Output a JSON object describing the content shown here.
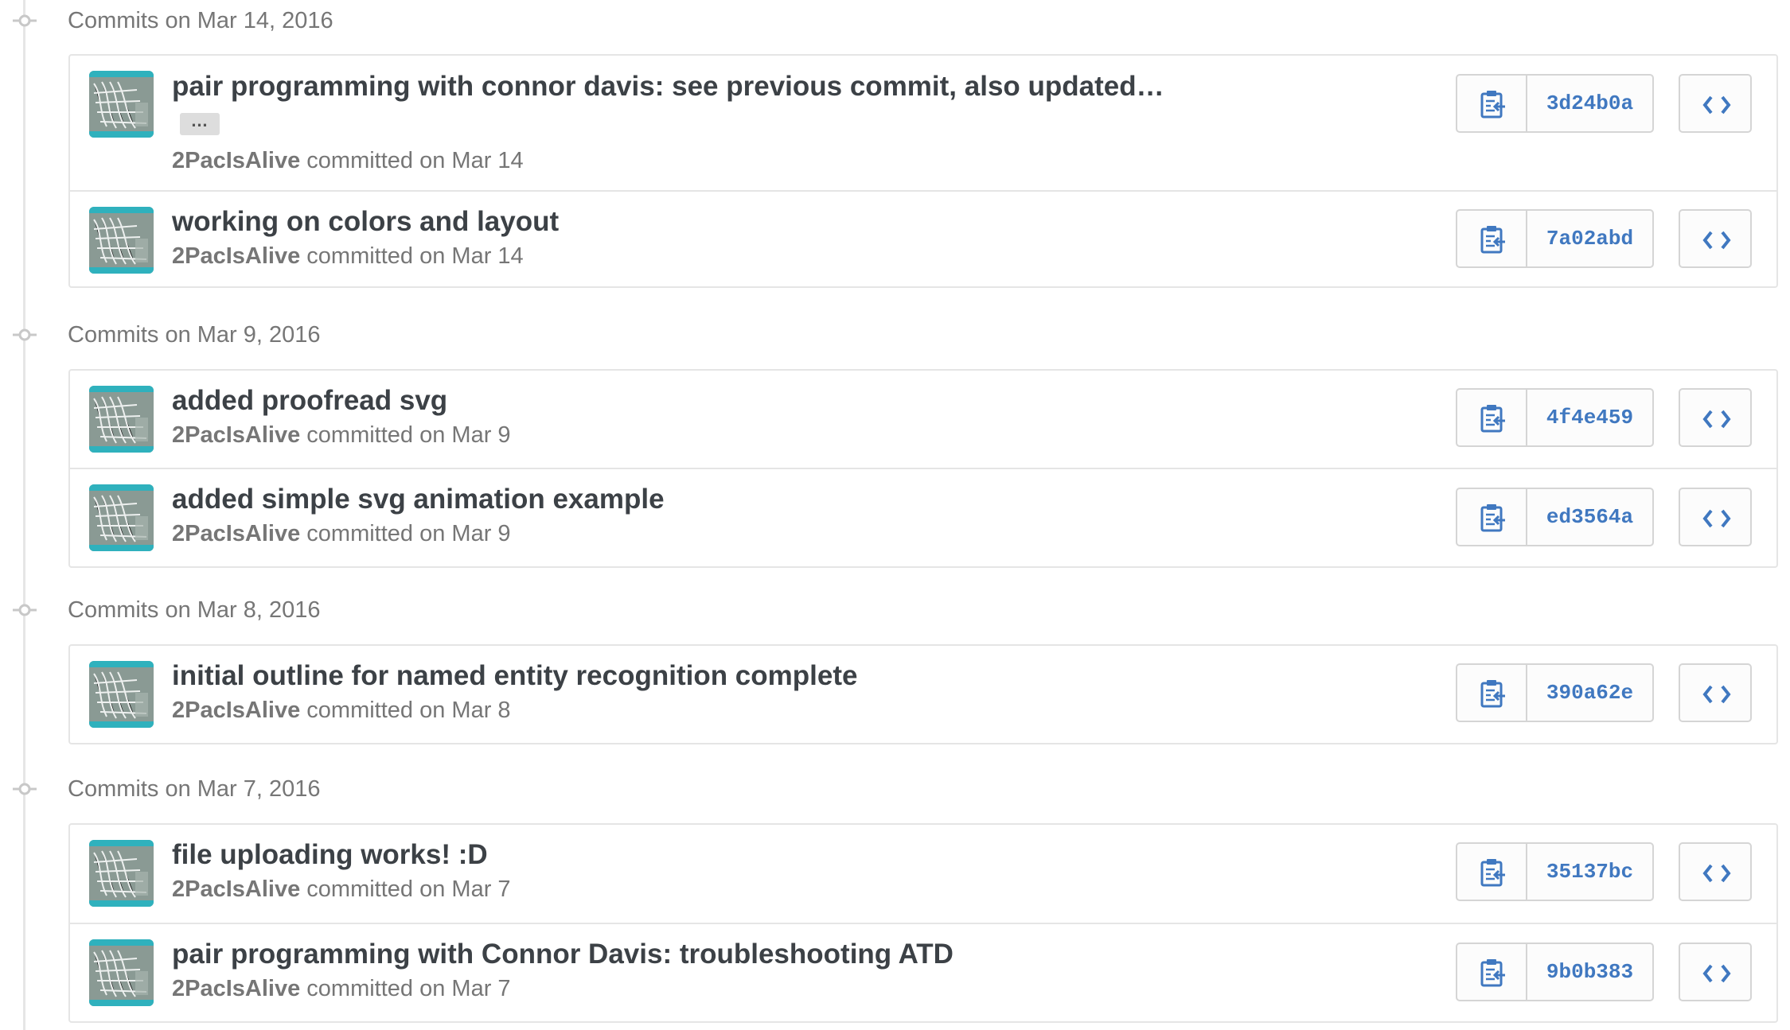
{
  "groups": [
    {
      "title": "Commits on Mar 14, 2016",
      "commits": [
        {
          "message": "pair programming with connor davis: see previous commit, also updated…",
          "ellipsis": "…",
          "author": "2PacIsAlive",
          "when": " committed on Mar 14",
          "sha": "3d24b0a"
        },
        {
          "message": "working on colors and layout",
          "author": "2PacIsAlive",
          "when": " committed on Mar 14",
          "sha": "7a02abd"
        }
      ]
    },
    {
      "title": "Commits on Mar 9, 2016",
      "commits": [
        {
          "message": "added proofread svg",
          "author": "2PacIsAlive",
          "when": " committed on Mar 9",
          "sha": "4f4e459"
        },
        {
          "message": "added simple svg animation example",
          "author": "2PacIsAlive",
          "when": " committed on Mar 9",
          "sha": "ed3564a"
        }
      ]
    },
    {
      "title": "Commits on Mar 8, 2016",
      "commits": [
        {
          "message": "initial outline for named entity recognition complete",
          "author": "2PacIsAlive",
          "when": " committed on Mar 8",
          "sha": "390a62e"
        }
      ]
    },
    {
      "title": "Commits on Mar 7, 2016",
      "commits": [
        {
          "message": "file uploading works! :D",
          "author": "2PacIsAlive",
          "when": " committed on Mar 7",
          "sha": "35137bc"
        },
        {
          "message": "pair programming with Connor Davis: troubleshooting ATD",
          "author": "2PacIsAlive",
          "when": " committed on Mar 7",
          "sha": "9b0b383"
        }
      ]
    }
  ],
  "icons": {
    "node": "git-commit-icon",
    "clipboard": "clipboard-icon",
    "browse": "code-icon"
  },
  "colors": {
    "sha_link": "#4078c0",
    "border": "#e5e5e5",
    "muted_text": "#767676",
    "title_text": "#3c4146"
  }
}
